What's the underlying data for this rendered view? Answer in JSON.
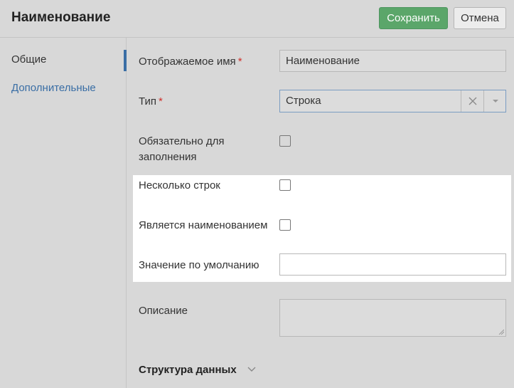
{
  "header": {
    "title": "Наименование",
    "save_label": "Сохранить",
    "cancel_label": "Отмена"
  },
  "sidebar": {
    "items": [
      {
        "label": "Общие",
        "active": true
      },
      {
        "label": "Дополнительные",
        "active": false
      }
    ]
  },
  "form": {
    "display_name": {
      "label": "Отображаемое имя",
      "required": "*",
      "value": "Наименование"
    },
    "type": {
      "label": "Тип",
      "required": "*",
      "value": "Строка"
    },
    "required_fill": {
      "label_line1": "Обязательно для",
      "label_line2": "заполнения",
      "checked": false
    },
    "multiline": {
      "label": "Несколько строк",
      "checked": false
    },
    "is_name": {
      "label": "Является наименованием",
      "checked": false
    },
    "default_value": {
      "label": "Значение по умолчанию",
      "value": ""
    },
    "description": {
      "label": "Описание",
      "value": ""
    },
    "data_structure": {
      "label": "Структура данных"
    }
  },
  "colors": {
    "accent": "#3a6ea5",
    "save_button": "#5ba66a",
    "required": "#d0302b"
  }
}
